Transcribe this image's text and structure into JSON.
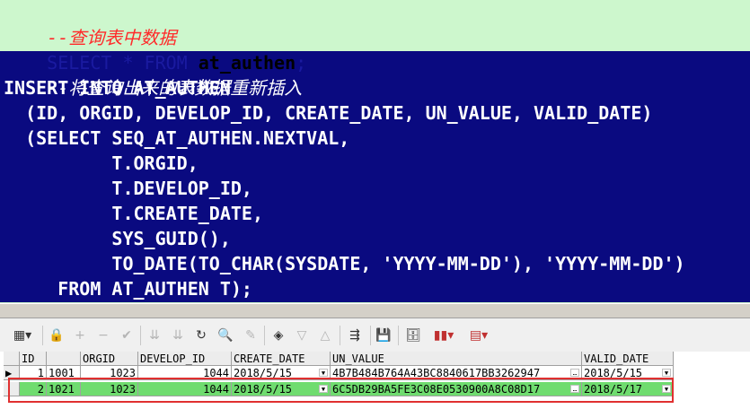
{
  "editor": {
    "comment1": "--查询表中数据",
    "select_keyword": "SELECT * FROM ",
    "select_table": "at_authen",
    "select_end": ";",
    "comment2": "--将查询出来的表数据重新插入",
    "insert_line": "INSERT INTO AT_AUTHEN",
    "columns_line": "  (ID, ORGID, DEVELOP_ID, CREATE_DATE, UN_VALUE, VALID_DATE)",
    "select2_line": "  (SELECT SEQ_AT_AUTHEN.NEXTVAL,",
    "col_orgid": "          T.ORGID,",
    "col_develop": "          T.DEVELOP_ID,",
    "col_create": "          T.CREATE_DATE,",
    "col_guid": "          SYS_GUID(),",
    "col_todate": "          TO_DATE(TO_CHAR(SYSDATE, 'YYYY-MM-DD'), 'YYYY-MM-DD')",
    "from_line": "     FROM AT_AUTHEN T);"
  },
  "colors": {
    "editor_bg": "#cdf7cd",
    "selection_bg": "#0a0a80",
    "comment": "#ff2a2a",
    "row_highlight": "#6fdc6f",
    "annotation_box": "#e03030"
  },
  "toolbar": {
    "icons": [
      "grid-menu-icon",
      "lock-icon",
      "add-row-icon",
      "delete-row-icon",
      "post-icon",
      "first-record-icon",
      "last-record-icon",
      "refresh-icon",
      "find-icon",
      "clear-icon",
      "query-icon",
      "triangle-down-icon",
      "triangle-up-icon",
      "export-icon",
      "save-icon",
      "connection-icon",
      "chart-icon",
      "table-export-icon"
    ]
  },
  "grid": {
    "headers": [
      "ID",
      "ORGID",
      "DEVELOP_ID",
      "CREATE_DATE",
      "UN_VALUE",
      "VALID_DATE"
    ],
    "rows": [
      {
        "num": "1",
        "id": "1001",
        "orgid": "1023",
        "develop_id": "1044",
        "create_date": "2018/5/15",
        "un_value": "4B7B484B764A43BC8840617BB3262947",
        "valid_date": "2018/5/15"
      },
      {
        "num": "2",
        "id": "1021",
        "orgid": "1023",
        "develop_id": "1044",
        "create_date": "2018/5/15",
        "un_value": "6C5DB29BA5FE3C08E0530900A8C08D17",
        "valid_date": "2018/5/17"
      }
    ]
  }
}
